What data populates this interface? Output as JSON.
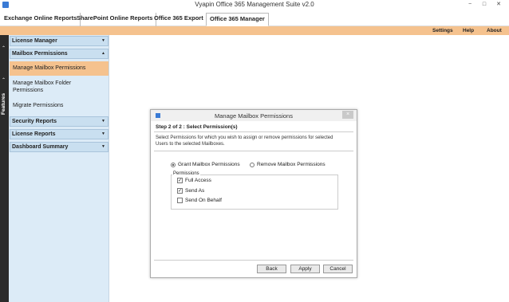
{
  "window": {
    "title": "Vyapin Office 365 Management Suite v2.0",
    "icon": "app-icon"
  },
  "tabs": [
    {
      "label": "Exchange Online Reports"
    },
    {
      "label": "SharePoint Online Reports"
    },
    {
      "label": "Office 365 Export"
    },
    {
      "label": "Office 365 Manager"
    }
  ],
  "toplinks": {
    "settings": "Settings",
    "help": "Help",
    "about": "About"
  },
  "features_label": "Features",
  "sidebar": {
    "license_manager": "License Manager",
    "mailbox_permissions": "Mailbox Permissions",
    "manage_mailbox_permissions": "Manage Mailbox Permissions",
    "manage_mailbox_folder_1": "Manage Mailbox Folder",
    "manage_mailbox_folder_2": "Permissions",
    "migrate_permissions": "Migrate Permissions",
    "security_reports": "Security Reports",
    "license_reports": "License Reports",
    "dashboard_summary": "Dashboard Summary"
  },
  "dialog": {
    "title": "Manage Mailbox Permissions",
    "step": "Step 2 of 2 : Select Permission(s)",
    "desc_1": "Select Permissions for which you wish to assign or remove permissions for selected",
    "desc_2": "Users to the selected Mailboxes.",
    "grant": "Grant Mailbox Permissions",
    "remove": "Remove Mailbox Permissions",
    "permissions_legend": "Permissions",
    "full_access": "Full Access",
    "send_as": "Send As",
    "send_on_behalf": "Send On Behalf",
    "back": "Back",
    "apply": "Apply",
    "cancel": "Cancel",
    "close": "×"
  },
  "state": {
    "selected_radio": "grant",
    "full_access_checked": true,
    "send_as_checked": true,
    "send_on_behalf_checked": false
  },
  "colors": {
    "accent": "#f5c28e",
    "sidebar_bg": "#dcebf7",
    "section_bg": "#c9dff0",
    "strip": "#2b2b2b"
  }
}
